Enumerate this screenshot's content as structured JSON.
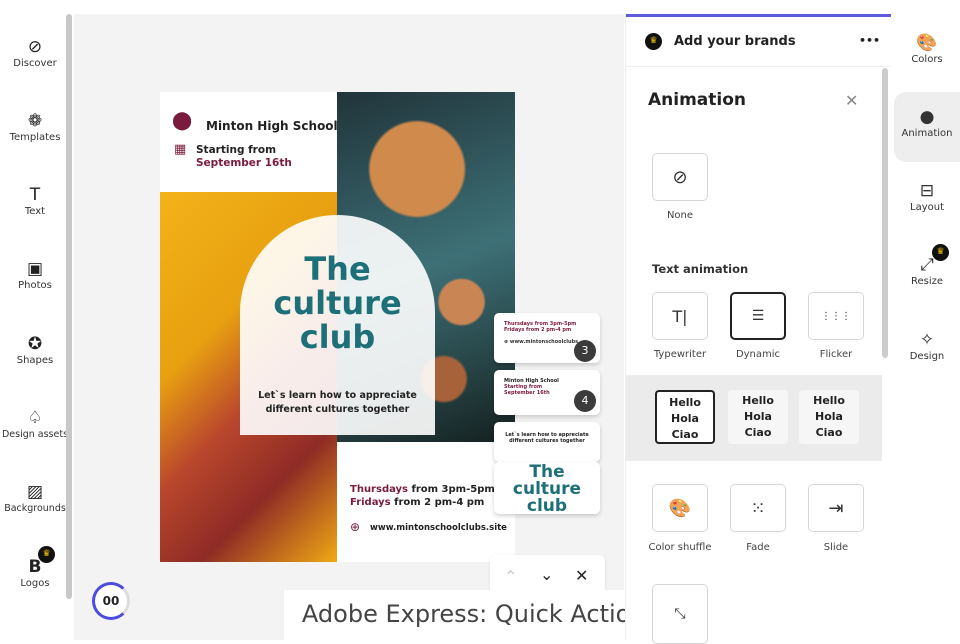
{
  "left_sidebar": {
    "items": [
      {
        "label": "Discover",
        "icon": "compass-icon",
        "glyph": "⊘"
      },
      {
        "label": "Templates",
        "icon": "templates-icon",
        "glyph": "❁"
      },
      {
        "label": "Text",
        "icon": "text-icon",
        "glyph": "T"
      },
      {
        "label": "Photos",
        "icon": "photo-icon",
        "glyph": "▣"
      },
      {
        "label": "Shapes",
        "icon": "shapes-icon",
        "glyph": "✪"
      },
      {
        "label": "Design assets",
        "icon": "design-assets-icon",
        "glyph": "♤"
      },
      {
        "label": "Backgrounds",
        "icon": "backgrounds-icon",
        "glyph": "▨"
      },
      {
        "label": "Logos",
        "icon": "logo-icon",
        "glyph": "B",
        "premium": true
      }
    ]
  },
  "poster": {
    "school": "Minton High School",
    "starting": "Starting from",
    "date": "September 16th",
    "title_1": "The",
    "title_2": "culture",
    "title_3": "club",
    "tagline_1": "Let`s learn how to appreciate",
    "tagline_2": "different cultures together",
    "day1": "Thursdays",
    "time1": " from 3pm-5pm",
    "day2": "Fridays",
    "time2": " from 2 pm-4 pm",
    "website": "www.mintonschoolclubs.site"
  },
  "scene_cards": [
    {
      "number": "3"
    },
    {
      "number": "4"
    }
  ],
  "playback": {
    "pause_label": "00"
  },
  "caption": "Adobe Express: Quick Actions",
  "panel": {
    "brand_title": "Add your brands",
    "more": "•••",
    "title": "Animation",
    "close": "✕",
    "none_label": "None",
    "text_animation_heading": "Text animation",
    "text_animations": [
      {
        "label": "Typewriter",
        "glyph": "T|"
      },
      {
        "label": "Dynamic",
        "glyph": "☰",
        "selected": true
      },
      {
        "label": "Flicker",
        "glyph": "⋮⋮⋮"
      }
    ],
    "dynamic_variants": [
      {
        "l1": "Hello",
        "l2": "Hola",
        "l3": "Ciao",
        "selected": true
      },
      {
        "l1": "Hello",
        "l2": "Hola",
        "l3": "Ciao"
      },
      {
        "l1": "Hello",
        "l2": "Hola",
        "l3": "Ciao"
      }
    ],
    "other_animations": [
      {
        "label": "Color shuffle",
        "glyph": "🎨"
      },
      {
        "label": "Fade",
        "glyph": "⁙"
      },
      {
        "label": "Slide",
        "glyph": "⇥"
      }
    ],
    "accent": "#5b5bdc"
  },
  "right_rail": {
    "items": [
      {
        "label": "Colors",
        "glyph": "🎨"
      },
      {
        "label": "Animation",
        "glyph": "●",
        "active": true
      },
      {
        "label": "Layout",
        "glyph": "⊟"
      },
      {
        "label": "Resize",
        "glyph": "⤢",
        "premium": true
      },
      {
        "label": "Design",
        "glyph": "✧"
      }
    ]
  }
}
